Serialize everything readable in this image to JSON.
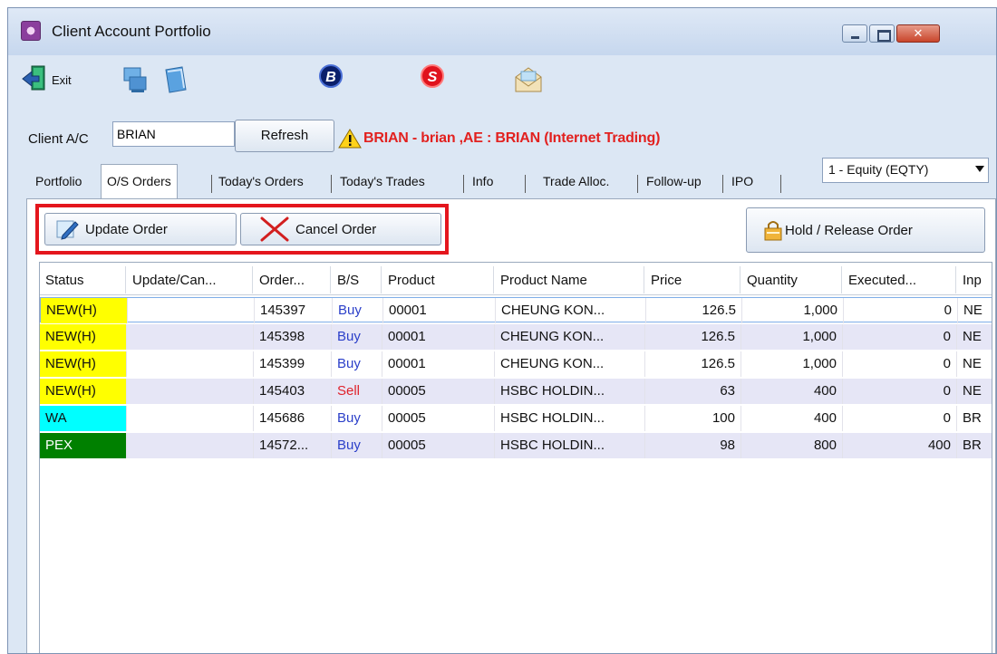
{
  "window": {
    "title": "Client Account Portfolio",
    "close_glyph": "✕"
  },
  "toolbar": {
    "exit_label": "Exit",
    "b_icon_letter": "B",
    "s_icon_letter": "S"
  },
  "client": {
    "label": "Client A/C",
    "value": "BRIAN",
    "refresh_label": "Refresh",
    "info": "BRIAN - brian ,AE : BRIAN (Internet Trading)"
  },
  "tabs": [
    {
      "label": "Portfolio"
    },
    {
      "label": "O/S Orders"
    },
    {
      "label": "Today's Orders"
    },
    {
      "label": "Today's Trades"
    },
    {
      "label": "Info"
    },
    {
      "label": "Trade Alloc."
    },
    {
      "label": "Follow-up"
    },
    {
      "label": "IPO"
    }
  ],
  "market_select": {
    "value": "1 - Equity (EQTY)"
  },
  "actions": {
    "update_label": "Update Order",
    "cancel_label": "Cancel Order",
    "hold_label": "Hold / Release Order"
  },
  "grid": {
    "headers": [
      "Status",
      "Update/Can...",
      "Order...",
      "B/S",
      "Product",
      "Product Name",
      "Price",
      "Quantity",
      "Executed...",
      "Inp"
    ],
    "rows": [
      {
        "status": "NEW(H)",
        "status_color": "#ffff00",
        "update": "",
        "order": "145397",
        "bs": "Buy",
        "product": "00001",
        "name": "CHEUNG KON...",
        "price": "126.5",
        "qty": "1,000",
        "executed": "0",
        "inp": "NE"
      },
      {
        "status": "NEW(H)",
        "status_color": "#ffff00",
        "update": "",
        "order": "145398",
        "bs": "Buy",
        "product": "00001",
        "name": "CHEUNG KON...",
        "price": "126.5",
        "qty": "1,000",
        "executed": "0",
        "inp": "NE"
      },
      {
        "status": "NEW(H)",
        "status_color": "#ffff00",
        "update": "",
        "order": "145399",
        "bs": "Buy",
        "product": "00001",
        "name": "CHEUNG KON...",
        "price": "126.5",
        "qty": "1,000",
        "executed": "0",
        "inp": "NE"
      },
      {
        "status": "NEW(H)",
        "status_color": "#ffff00",
        "update": "",
        "order": "145403",
        "bs": "Sell",
        "product": "00005",
        "name": "HSBC HOLDIN...",
        "price": "63",
        "qty": "400",
        "executed": "0",
        "inp": "NE"
      },
      {
        "status": "WA",
        "status_color": "#00ffff",
        "update": "",
        "order": "145686",
        "bs": "Buy",
        "product": "00005",
        "name": "HSBC HOLDIN...",
        "price": "100",
        "qty": "400",
        "executed": "0",
        "inp": "BR"
      },
      {
        "status": "PEX",
        "status_color": "#008000",
        "update": "",
        "order": "14572...",
        "bs": "Buy",
        "product": "00005",
        "name": "HSBC HOLDIN...",
        "price": "98",
        "qty": "800",
        "executed": "400",
        "inp": "BR"
      }
    ]
  }
}
